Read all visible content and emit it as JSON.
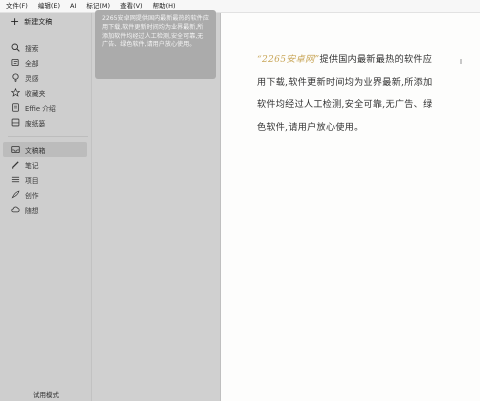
{
  "menubar": {
    "items": [
      "文件(F)",
      "编辑(E)",
      "AI",
      "标记(M)",
      "查看(V)",
      "帮助(H)"
    ]
  },
  "sidebar": {
    "new_label": "新建文稿",
    "items": [
      "搜索",
      "全部",
      "灵感",
      "收藏夹",
      "Effie 介绍",
      "废纸篓"
    ],
    "folders": [
      "文稿箱",
      "笔记",
      "项目",
      "创作",
      "随想"
    ],
    "active_folder": "文稿箱",
    "trial_label": "试用模式"
  },
  "list": {
    "card_text": "2265安卓网提供国内最新最热的软件应用下载,软件更新时间均为业界最新,所添加软件均经过人工检测,安全可靠,无广告、绿色软件,请用户放心使用。"
  },
  "editor": {
    "highlight": "“2265安卓网”",
    "body": "提供国内最新最热的软件应用下载,软件更新时间均为业界最新,所添加软件均经过人工检测,安全可靠,无广告、绿色软件,请用户放心使用。",
    "highlight_color": "#c9a75a"
  }
}
